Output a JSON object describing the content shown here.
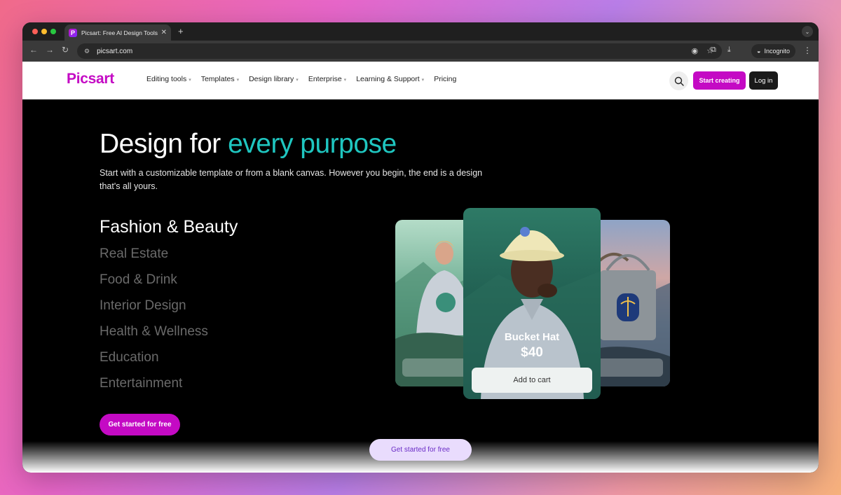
{
  "browser": {
    "tab_title": "Picsart: Free AI Design Tools",
    "tab_close": "✕",
    "new_tab": "+",
    "url": "picsart.com",
    "incognito_label": "Incognito"
  },
  "site_nav": {
    "logo": "Picsart",
    "links": [
      {
        "label": "Editing tools",
        "dropdown": true
      },
      {
        "label": "Templates",
        "dropdown": true
      },
      {
        "label": "Design library",
        "dropdown": true
      },
      {
        "label": "Enterprise",
        "dropdown": true
      },
      {
        "label": "Learning & Support",
        "dropdown": true
      },
      {
        "label": "Pricing",
        "dropdown": false
      }
    ],
    "start_button": "Start creating",
    "login_button": "Log in"
  },
  "hero": {
    "title_plain": "Design for ",
    "title_accent": "every purpose",
    "subtitle": "Start with a customizable template or from a blank canvas. However you begin, the end is a design that's all yours.",
    "categories": [
      "Fashion & Beauty",
      "Real Estate",
      "Food & Drink",
      "Interior Design",
      "Health & Wellness",
      "Education",
      "Entertainment"
    ],
    "active_category": "Fashion & Beauty",
    "cta": "Get started for free"
  },
  "product_card": {
    "title": "Bucket Hat",
    "price": "$40",
    "button": "Add to cart"
  },
  "floating_cta": "Get started for free",
  "colors": {
    "brand": "#c40ac4",
    "accent": "#1fc6c0"
  }
}
